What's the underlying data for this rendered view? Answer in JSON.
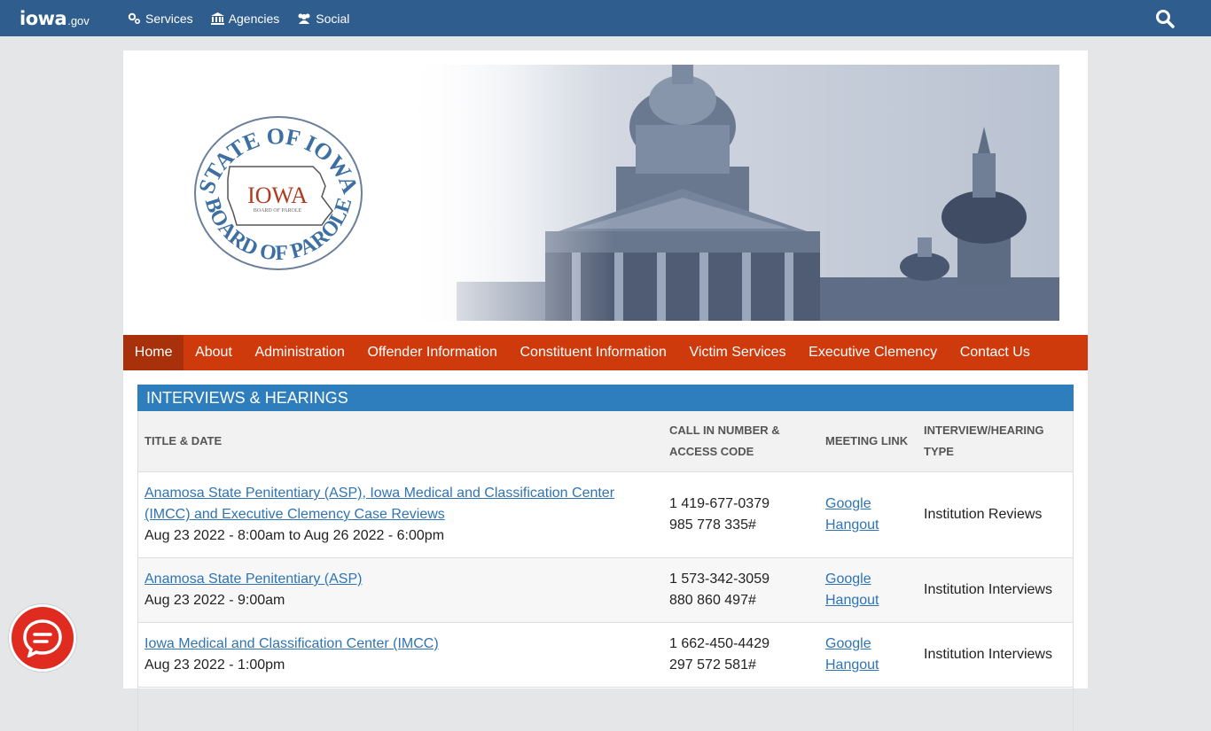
{
  "topbar": {
    "logo_word": "iowa",
    "logo_gov": ".gov",
    "nav": [
      {
        "label": "Services",
        "icon": "gears-icon"
      },
      {
        "label": "Agencies",
        "icon": "building-icon"
      },
      {
        "label": "Social",
        "icon": "users-icon"
      }
    ],
    "search_icon": "search-icon"
  },
  "banner": {
    "seal_top_text": "STATE OF IOWA",
    "seal_center_text": "IOWA",
    "seal_small_text": "BOARD OF PAROLE",
    "seal_bottom_text": "BOARD OF PAROLE"
  },
  "mainnav": {
    "items": [
      {
        "label": "Home",
        "active": true
      },
      {
        "label": "About"
      },
      {
        "label": "Administration"
      },
      {
        "label": "Offender Information"
      },
      {
        "label": "Constituent Information"
      },
      {
        "label": "Victim Services"
      },
      {
        "label": "Executive Clemency"
      },
      {
        "label": "Contact Us"
      }
    ]
  },
  "section": {
    "title": "INTERVIEWS & HEARINGS",
    "columns": [
      "TITLE & DATE",
      "CALL IN NUMBER & ACCESS CODE",
      "MEETING LINK",
      "INTERVIEW/HEARING TYPE"
    ],
    "rows": [
      {
        "title": "Anamosa State Penitentiary (ASP), Iowa Medical and Classification Center (IMCC) and Executive Clemency Case Reviews",
        "date": "Aug 23 2022 - 8:00am to Aug 26 2022 - 6:00pm",
        "phone": "1 419-677-0379",
        "code": "985 778 335#",
        "link": "Google Hangout",
        "type": "Institution Reviews"
      },
      {
        "title": "Anamosa State Penitentiary (ASP)",
        "date": "Aug 23 2022 - 9:00am",
        "phone": "1 573-342-3059",
        "code": "880 860 497#",
        "link": "Google Hangout",
        "type": "Institution Interviews"
      },
      {
        "title": "Iowa Medical and Classification Center (IMCC)",
        "date": "Aug 23 2022 - 1:00pm",
        "phone": "1 662-450-4429",
        "code": "297 572 581#",
        "link": "Google Hangout",
        "type": "Institution Interviews"
      }
    ]
  },
  "chat": {
    "icon": "chat-icon"
  },
  "colors": {
    "topbar": "#2f5d8e",
    "nav": "#cf3a0c",
    "nav_active": "#a8300a",
    "section": "#2e7ebd",
    "link": "#2e74b5",
    "chat": "#e02b20"
  }
}
